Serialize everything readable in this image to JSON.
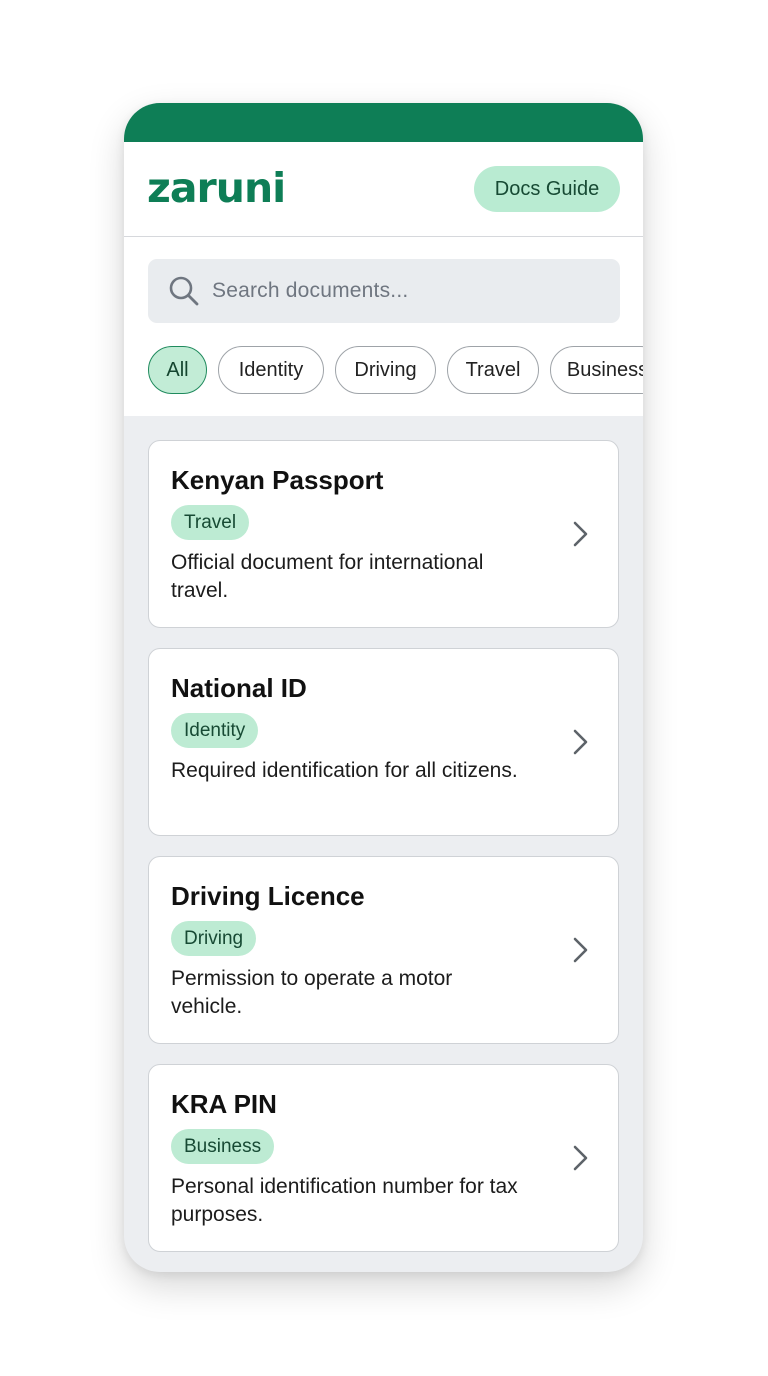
{
  "app": {
    "logo": "zaruni",
    "docs_guide_label": "Docs Guide"
  },
  "search": {
    "placeholder": "Search documents..."
  },
  "filters": [
    "All",
    "Identity",
    "Driving",
    "Travel",
    "Business"
  ],
  "active_filter": "All",
  "documents": [
    {
      "title": "Kenyan Passport",
      "category": "Travel",
      "description": "Official document for international travel."
    },
    {
      "title": "National ID",
      "category": "Identity",
      "description": "Required identification for all citizens."
    },
    {
      "title": "Driving Licence",
      "category": "Driving",
      "description": "Permission to operate a motor vehicle."
    },
    {
      "title": "KRA PIN",
      "category": "Business",
      "description": "Personal identification number for tax purposes."
    }
  ],
  "colors": {
    "brand": "#0e7e56",
    "chip_active_bg": "#c2ecd6",
    "tag_bg": "#bdebd3"
  },
  "icons": {
    "search": "search-icon",
    "card_arrow": "chevron-right-icon"
  }
}
